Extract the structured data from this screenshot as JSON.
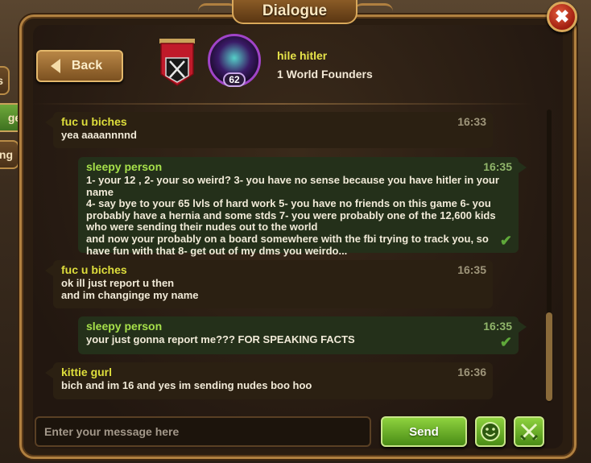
{
  "window": {
    "title": "Dialogue",
    "close_label": "✖"
  },
  "side_tabs": [
    {
      "label": "s",
      "active": false
    },
    {
      "label": "ges",
      "active": true
    },
    {
      "label": "ng",
      "active": false
    }
  ],
  "header": {
    "back_label": "Back",
    "user_name": "hile hitler",
    "guild": "1 World Founders",
    "level": "62"
  },
  "messages": [
    {
      "sender": "fuc u biches",
      "time": "16:33",
      "text": "yea aaaannnnd",
      "mine": false
    },
    {
      "sender": "sleepy person",
      "time": "16:35",
      "text": "1- your 12 , 2- your so weird? 3- you have no sense because you have hitler in your name\n4- say bye to your 65 lvls of hard work 5- you have no friends on this game 6- you probably have a hernia and some stds 7- you were probably one of the 12,600 kids who were sending their nudes out to the world\nand now your probably on a board somewhere with the fbi trying to track you, so have fun with that 8- get out of my dms you weirdo...",
      "mine": true
    },
    {
      "sender": "fuc u biches",
      "time": "16:35",
      "text": "ok ill just report u then\nand im changinge my name",
      "mine": false
    },
    {
      "sender": "sleepy person",
      "time": "16:35",
      "text": "your just gonna report me??? FOR SPEAKING FACTS",
      "mine": true
    },
    {
      "sender": "kittie gurl",
      "time": "16:36",
      "text": "bich and im 16 and yes im sending nudes boo hoo",
      "mine": false
    }
  ],
  "composer": {
    "placeholder": "Enter your message here",
    "send_label": "Send",
    "emoji_icon": "smiley-icon",
    "swords_icon": "crossed-swords-icon"
  },
  "colors": {
    "accent_green": "#6ab02a",
    "sender_yellow": "#dede3c",
    "own_sender_green": "#a6e04a",
    "frame_gold": "#b08040"
  }
}
